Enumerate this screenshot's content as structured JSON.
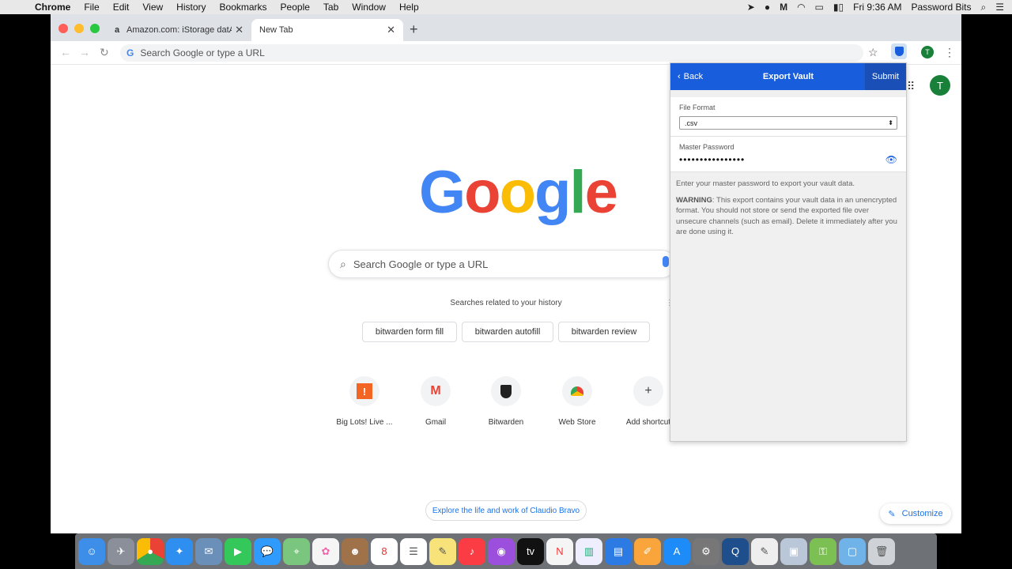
{
  "menubar": {
    "app": "Chrome",
    "items": [
      "File",
      "Edit",
      "View",
      "History",
      "Bookmarks",
      "People",
      "Tab",
      "Window",
      "Help"
    ],
    "clock": "Fri 9:36 AM",
    "user": "Password Bits"
  },
  "tabs": [
    {
      "title": "Amazon.com: iStorage datAshur",
      "favicon": "a"
    },
    {
      "title": "New Tab",
      "favicon": ""
    }
  ],
  "omnibox": {
    "placeholder": "Search Google or type a URL"
  },
  "newtab": {
    "logo": [
      "G",
      "o",
      "o",
      "g",
      "l",
      "e"
    ],
    "logo_colors": [
      "#4285f4",
      "#ea4335",
      "#fbbc05",
      "#4285f4",
      "#34a853",
      "#ea4335"
    ],
    "search_placeholder": "Search Google or type a URL",
    "related_title": "Searches related to your history",
    "chips": [
      "bitwarden form fill",
      "bitwarden autofill",
      "bitwarden review"
    ],
    "shortcuts": [
      {
        "label": "Big Lots! Live ...",
        "icon": "!"
      },
      {
        "label": "Gmail",
        "icon": "M"
      },
      {
        "label": "Bitwarden",
        "icon": "shield"
      },
      {
        "label": "Web Store",
        "icon": "store"
      },
      {
        "label": "Add shortcut",
        "icon": "+"
      }
    ],
    "explore": "Explore the life and work of Claudio Bravo",
    "customize": "Customize",
    "avatar": "T"
  },
  "popup": {
    "back": "Back",
    "title": "Export Vault",
    "submit": "Submit",
    "file_format_label": "File Format",
    "file_format_value": ".csv",
    "master_password_label": "Master Password",
    "master_password_mask": "••••••••••••••••",
    "help_text": "Enter your master password to export your vault data.",
    "warning_label": "WARNING",
    "warning_text": ": This export contains your vault data in an unencrypted format. You should not store or send the exported file over unsecure channels (such as email). Delete it immediately after you are done using it."
  },
  "toolbar": {
    "avatar": "T"
  }
}
